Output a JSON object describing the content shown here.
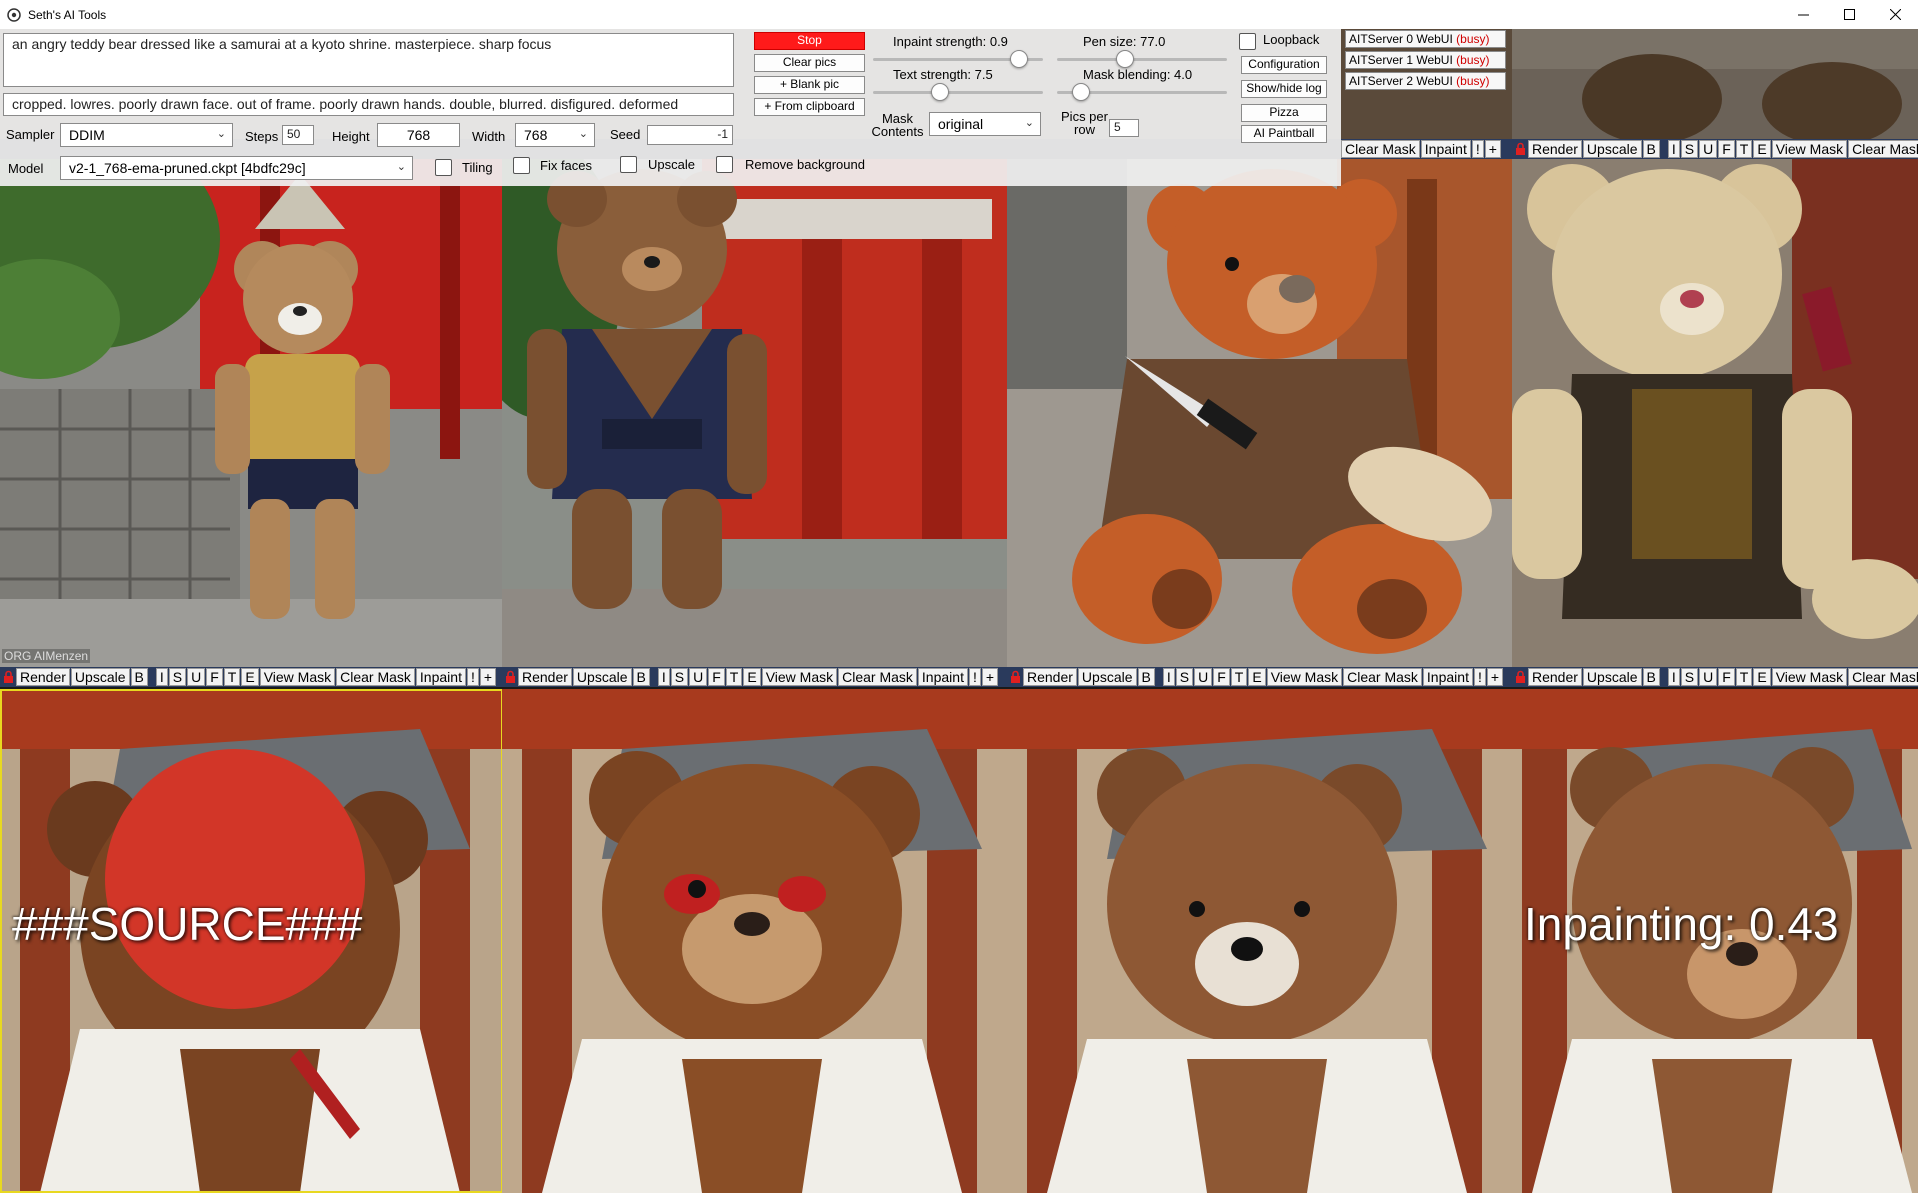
{
  "window": {
    "title": "Seth's AI Tools"
  },
  "prompt": {
    "positive": "an angry teddy bear dressed like a samurai at a kyoto shrine. masterpiece. sharp focus",
    "negative": "cropped. lowres. poorly drawn face. out of frame. poorly drawn hands. double, blurred. disfigured. deformed"
  },
  "buttons": {
    "stop": "Stop",
    "clear_pics": "Clear pics",
    "blank_pic": "+ Blank pic",
    "from_clipboard": "+ From clipboard",
    "configuration": "Configuration",
    "show_hide_log": "Show/hide log",
    "pizza": "Pizza",
    "ai_paintball": "AI Paintball"
  },
  "sliders": {
    "inpaint_strength": {
      "label": "Inpaint strength: 0.9",
      "fraction": 0.9
    },
    "text_strength": {
      "label": "Text strength: 7.5",
      "fraction": 0.38
    },
    "pen_size": {
      "label": "Pen size: 77.0",
      "fraction": 0.39
    },
    "mask_blending": {
      "label": "Mask blending: 4.0",
      "fraction": 0.1
    }
  },
  "options": {
    "sampler_label": "Sampler",
    "sampler_value": "DDIM",
    "steps_label": "Steps",
    "steps_value": "50",
    "height_label": "Height",
    "height_value": "768",
    "width_label": "Width",
    "width_value": "768",
    "seed_label": "Seed",
    "seed_value": "-1",
    "model_label": "Model",
    "model_value": "v2-1_768-ema-pruned.ckpt [4bdfc29c]",
    "mask_contents_label": "Mask Contents",
    "mask_contents_value": "original",
    "pics_per_row_label": "Pics per row",
    "pics_per_row_value": "5",
    "loopback_label": "Loopback",
    "tiling_label": "Tiling",
    "fix_faces_label": "Fix faces",
    "upscale_label": "Upscale",
    "remove_background_label": "Remove background"
  },
  "servers": [
    {
      "name": "AITServer 0 WebUI",
      "status": "(busy)"
    },
    {
      "name": "AITServer 1 WebUI",
      "status": "(busy)"
    },
    {
      "name": "AITServer 2 WebUI",
      "status": "(busy)"
    }
  ],
  "tile_toolbar": {
    "render": "Render",
    "upscale": "Upscale",
    "b": "B",
    "i": "I",
    "s": "S",
    "u": "U",
    "f": "F",
    "t": "T",
    "e": "E",
    "view_mask": "View Mask",
    "clear_mask": "Clear Mask",
    "inpaint": "Inpaint",
    "bang": "!",
    "plus": "+"
  },
  "tile_overlays": {
    "source": "###SOURCE###",
    "inpainting": "Inpainting: 0.43",
    "corner_tag": "ORG AIMenzen"
  },
  "colors": {
    "stop_button": "#ff1a1a",
    "busy_status": "#d00000",
    "toolbar_bg": "#2a3a5c",
    "selected_frame": "#e8d820"
  }
}
